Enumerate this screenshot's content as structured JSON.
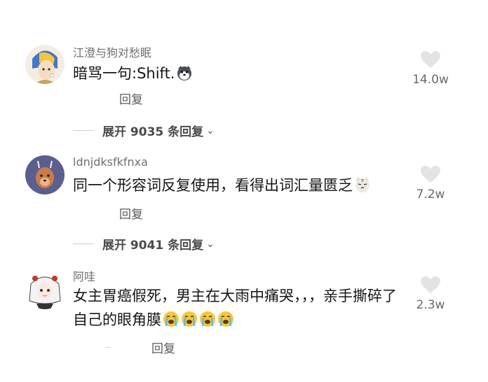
{
  "comments": [
    {
      "username": "江澄与狗对愁眠",
      "text": "暗骂一句:Shift.",
      "reply_label": "回复",
      "likes": "14.0w",
      "expand_label": "展开 9035 条回复"
    },
    {
      "username": "ldnjdksfkfnxa",
      "text": "同一个形容词反复使用，看得出词汇量匮乏",
      "reply_label": "回复",
      "likes": "7.2w",
      "expand_label": "展开 9041 条回复"
    },
    {
      "username": "阿哇",
      "text": "女主胃癌假死，男主在大雨中痛哭，，，亲手撕碎了自己的眼角膜",
      "reply_label": "回复",
      "likes": "2.3w"
    }
  ],
  "icons": {
    "like": "heart-icon",
    "expand": "chevron-down-icon",
    "emoji_dog": "husky-emoji-icon",
    "emoji_cat": "cat-emoji-icon",
    "emoji_cry": "crying-emoji-icon"
  },
  "colors": {
    "username": "#6f6f6f",
    "text": "#161616",
    "heart": "#e3e3e3",
    "cry_emoji": "#f6c63b"
  }
}
